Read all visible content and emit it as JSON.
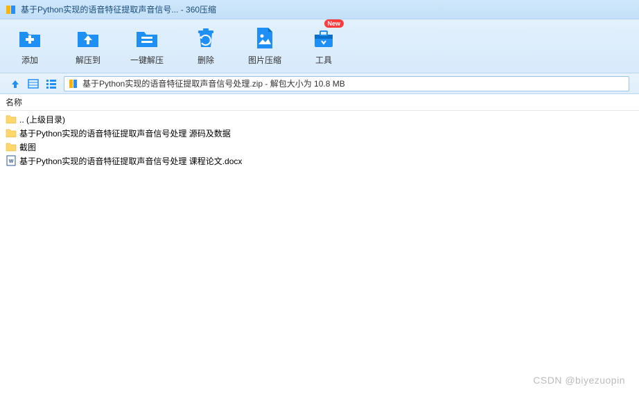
{
  "window": {
    "title": "基于Python实现的语音特征提取声音信号... - 360压缩"
  },
  "toolbar": {
    "items": [
      {
        "label": "添加"
      },
      {
        "label": "解压到"
      },
      {
        "label": "一键解压"
      },
      {
        "label": "删除"
      },
      {
        "label": "图片压缩"
      },
      {
        "label": "工具",
        "badge": "New"
      }
    ]
  },
  "path": {
    "text": "基于Python实现的语音特征提取声音信号处理.zip - 解包大小为 10.8 MB"
  },
  "columns": {
    "name": "名称"
  },
  "files": [
    {
      "name": ".. (上级目录)",
      "type": "folder"
    },
    {
      "name": "基于Python实现的语音特征提取声音信号处理 源码及数据",
      "type": "folder"
    },
    {
      "name": "截图",
      "type": "folder"
    },
    {
      "name": "基于Python实现的语音特征提取声音信号处理 课程论文.docx",
      "type": "docx"
    }
  ],
  "watermark": "CSDN @biyezuopin"
}
